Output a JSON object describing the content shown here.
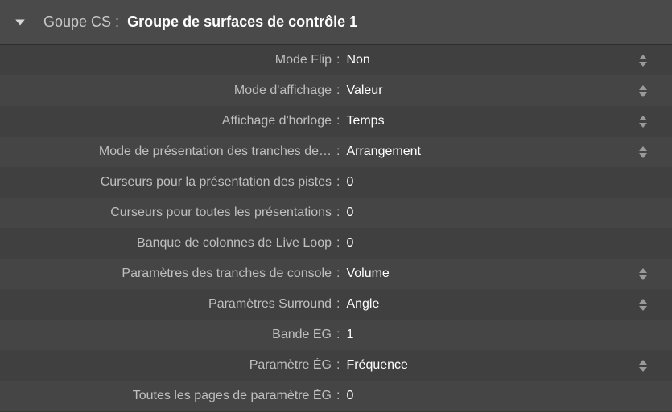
{
  "header": {
    "section_label": "Goupe CS :",
    "title": "Groupe de surfaces de contrôle 1"
  },
  "rows": [
    {
      "label": "Mode Flip",
      "value": "Non",
      "stepper": true
    },
    {
      "label": "Mode d'affichage",
      "value": "Valeur",
      "stepper": true
    },
    {
      "label": "Affichage d'horloge",
      "value": "Temps",
      "stepper": true
    },
    {
      "label": "Mode de présentation des tranches de…",
      "value": "Arrangement",
      "stepper": true
    },
    {
      "label": "Curseurs pour la présentation des pistes",
      "value": "0",
      "stepper": false
    },
    {
      "label": "Curseurs pour toutes les présentations",
      "value": "0",
      "stepper": false
    },
    {
      "label": "Banque de colonnes de Live Loop",
      "value": "0",
      "stepper": false
    },
    {
      "label": "Paramètres des tranches de console",
      "value": "Volume",
      "stepper": true
    },
    {
      "label": "Paramètres Surround",
      "value": "Angle",
      "stepper": true
    },
    {
      "label": "Bande ÉG",
      "value": "1",
      "stepper": false
    },
    {
      "label": "Paramètre ÉG",
      "value": "Fréquence",
      "stepper": true
    },
    {
      "label": "Toutes les pages de paramètre ÉG",
      "value": "0",
      "stepper": false
    }
  ]
}
